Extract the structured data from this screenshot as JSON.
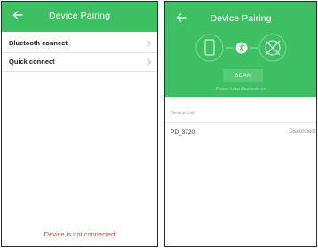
{
  "left_screen": {
    "title": "Device Pairing",
    "menu": [
      {
        "label": "Bluetooth connect"
      },
      {
        "label": "Quick connect"
      }
    ],
    "status_text": "Device is not connected"
  },
  "right_screen": {
    "title": "Device Pairing",
    "scan_label": "SCAN",
    "hint": "Please keep Bluetooth on",
    "section_title": "Device List",
    "devices": [
      {
        "name": "PD_3720",
        "action": "Disconnect"
      }
    ]
  },
  "colors": {
    "header_green": "#3fbf63",
    "status_red": "#e0463c"
  }
}
